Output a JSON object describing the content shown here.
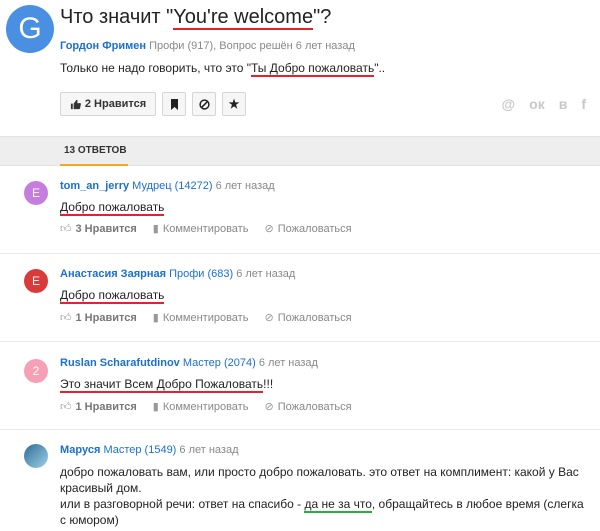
{
  "question": {
    "avatar_letter": "G",
    "title_prefix": "Что значит \"",
    "title_highlight": "You're welcome",
    "title_suffix": "\"?",
    "author": "Гордон Фримен",
    "rank": "Профи (917)",
    "status": ", Вопрос решён 6 лет назад",
    "body_prefix": "Только не надо говорить, что это \"",
    "body_highlight": "Ты Добро пожаловать",
    "body_suffix": "\".."
  },
  "actions": {
    "like_label": "2 Нравится"
  },
  "share": {
    "ok": "ок",
    "vk": "в",
    "fb": "f",
    "mail": "@"
  },
  "tab": {
    "label": "13 ОТВЕТОВ"
  },
  "answers": [
    {
      "avatar_letter": "E",
      "avatar_color": "#c77dde",
      "author": "tom_an_jerry",
      "rank": "Мудрец (14272)",
      "time": "6 лет назад",
      "text": "Добро пожаловать",
      "likes": "3 Нравится",
      "comment": "Комментировать",
      "report": "Пожаловаться"
    },
    {
      "avatar_letter": "E",
      "avatar_color": "#d93a3a",
      "author": "Анастасия Заярная",
      "rank": "Профи (683)",
      "time": "6 лет назад",
      "text": "Добро пожаловать",
      "likes": "1 Нравится",
      "comment": "Комментировать",
      "report": "Пожаловаться"
    },
    {
      "avatar_letter": "2",
      "avatar_color": "#f5a0b5",
      "author": "Ruslan Scharafutdinov",
      "rank": "Мастер (2074)",
      "time": "6 лет назад",
      "text_highlight": "Это значит Всем Добро Пожаловать",
      "text_suffix": "!!!",
      "likes": "1 Нравится",
      "comment": "Комментировать",
      "report": "Пожаловаться"
    },
    {
      "avatar_color": "#5aa0c8",
      "author": "Маруся",
      "rank": "Мастер (1549)",
      "time": "6 лет назад",
      "line1": "добро пожаловать вам, или просто добро пожаловать. это ответ на комплимент: какой у Вас красивый дом.",
      "line2_prefix": "или в разговорной речи: ответ на спасибо - ",
      "line2_highlight": "да не за что",
      "line2_suffix": ", обращайтесь в любое время (слегка с юмором)"
    }
  ]
}
